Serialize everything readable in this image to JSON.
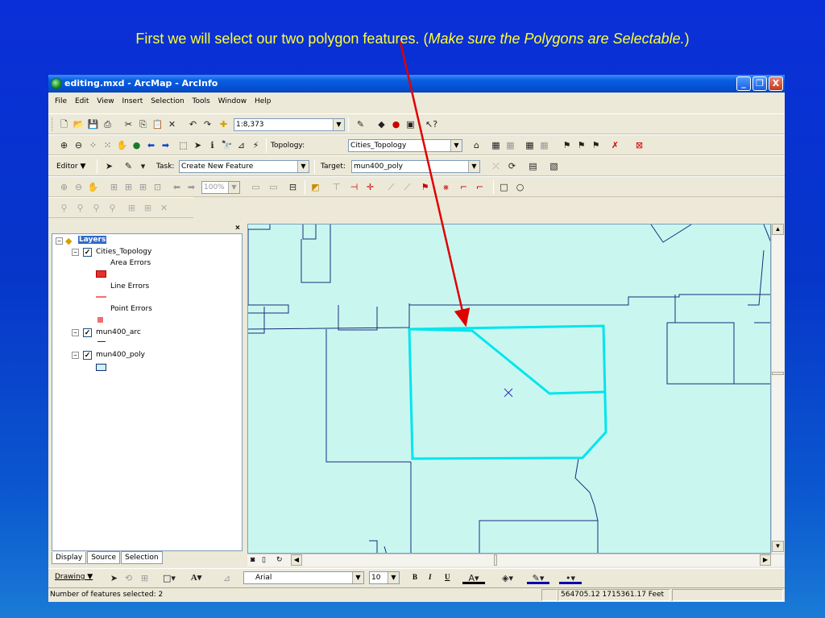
{
  "slide": {
    "title_prefix": "First we will select our two polygon features. (",
    "title_italic": "Make sure the Polygons are Selectable.",
    "title_suffix": ")",
    "title_color": "#ffff33",
    "arrow_color": "#e00000"
  },
  "window": {
    "title": "editing.mxd - ArcMap - ArcInfo",
    "min_label": "_",
    "max_label": "❐",
    "close_label": "X"
  },
  "menu": [
    "File",
    "Edit",
    "View",
    "Insert",
    "Selection",
    "Tools",
    "Window",
    "Help"
  ],
  "standard_toolbar": {
    "scale": "1:8,373"
  },
  "topology_toolbar": {
    "label": "Topology:",
    "value": "Cities_Topology"
  },
  "editor_toolbar": {
    "editor_label": "Editor ▼",
    "task_label": "Task:",
    "task_value": "Create New Feature",
    "target_label": "Target:",
    "target_value": "mun400_poly"
  },
  "layout_toolbar": {
    "zoom_value": "100%"
  },
  "toc": {
    "root": "Layers",
    "layers": [
      {
        "name": "Cities_Topology",
        "items": [
          "Area Errors",
          "Line Errors",
          "Point Errors"
        ]
      },
      {
        "name": "mun400_arc"
      },
      {
        "name": "mun400_poly"
      }
    ],
    "tabs": [
      "Display",
      "Source",
      "Selection"
    ],
    "close": "×"
  },
  "drawing_toolbar": {
    "drawing_label": "Drawing ▼",
    "font_name": "Arial",
    "font_size": "10",
    "bold": "B",
    "italic": "I",
    "underline": "U"
  },
  "status": {
    "message": "Number of features selected: 2",
    "coordinates": "564705.12  1715361.17 Feet"
  },
  "colors": {
    "map_fill": "#c9f7f0",
    "boundary": "#1a2b7a",
    "selection": "#00e5ee"
  }
}
